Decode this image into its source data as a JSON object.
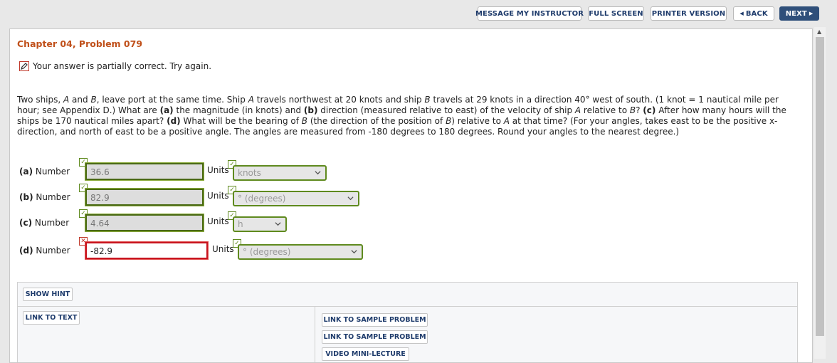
{
  "toolbar": {
    "message_instructor": "MESSAGE MY INSTRUCTOR",
    "full_screen": "FULL SCREEN",
    "printer_version": "PRINTER VERSION",
    "back": "BACK",
    "next": "NEXT"
  },
  "problem": {
    "title": "Chapter 04, Problem 079",
    "status": "Your answer is partially correct.  Try again.",
    "text_html": "Two ships, <i>A</i> and <i>B</i>, leave port at the same time. Ship <i>A</i> travels northwest at 20 knots and ship <i>B</i> travels at 29 knots in a direction 40° west of south. (1 knot = 1 nautical mile per hour; see Appendix D.) What are <b>(a)</b> the magnitude (in knots) and <b>(b)</b> direction (measured relative to east) of the velocity of ship <i>A</i> relative to <i>B</i>? <b>(c)</b> After how many hours will the ships be 170 nautical miles apart? <b>(d)</b> What will be the bearing of <i>B</i> (the direction of the position of <i>B</i>) relative to <i>A</i> at that time? (For your angles, takes east to be the positive x-direction, and north of east to be a positive angle. The angles are measured from -180 degrees to 180 degrees. Round your angles to the nearest degree.)"
  },
  "answers": [
    {
      "part": "(a)",
      "number_label": "Number",
      "value": "36.6",
      "units_label": "Units",
      "unit": "knots",
      "number_status": "correct",
      "unit_status": "correct"
    },
    {
      "part": "(b)",
      "number_label": "Number",
      "value": "82.9",
      "units_label": "Units",
      "unit": "° (degrees)",
      "number_status": "correct",
      "unit_status": "correct"
    },
    {
      "part": "(c)",
      "number_label": "Number",
      "value": "4.64",
      "units_label": "Units",
      "unit": "h",
      "number_status": "correct",
      "unit_status": "correct"
    },
    {
      "part": "(d)",
      "number_label": "Number",
      "value": "-82.9",
      "units_label": "Units",
      "unit": "° (degrees)",
      "number_status": "incorrect",
      "unit_status": "correct"
    }
  ],
  "resources": {
    "show_hint": "SHOW HINT",
    "link_to_text": "LINK TO TEXT",
    "links": [
      "LINK TO SAMPLE PROBLEM",
      "LINK TO SAMPLE PROBLEM",
      "VIDEO MINI-LECTURE"
    ]
  },
  "colors": {
    "title": "#c0501a",
    "correct": "#5f8a1e",
    "incorrect": "#c8141e",
    "button_text": "#1f3c6c"
  }
}
